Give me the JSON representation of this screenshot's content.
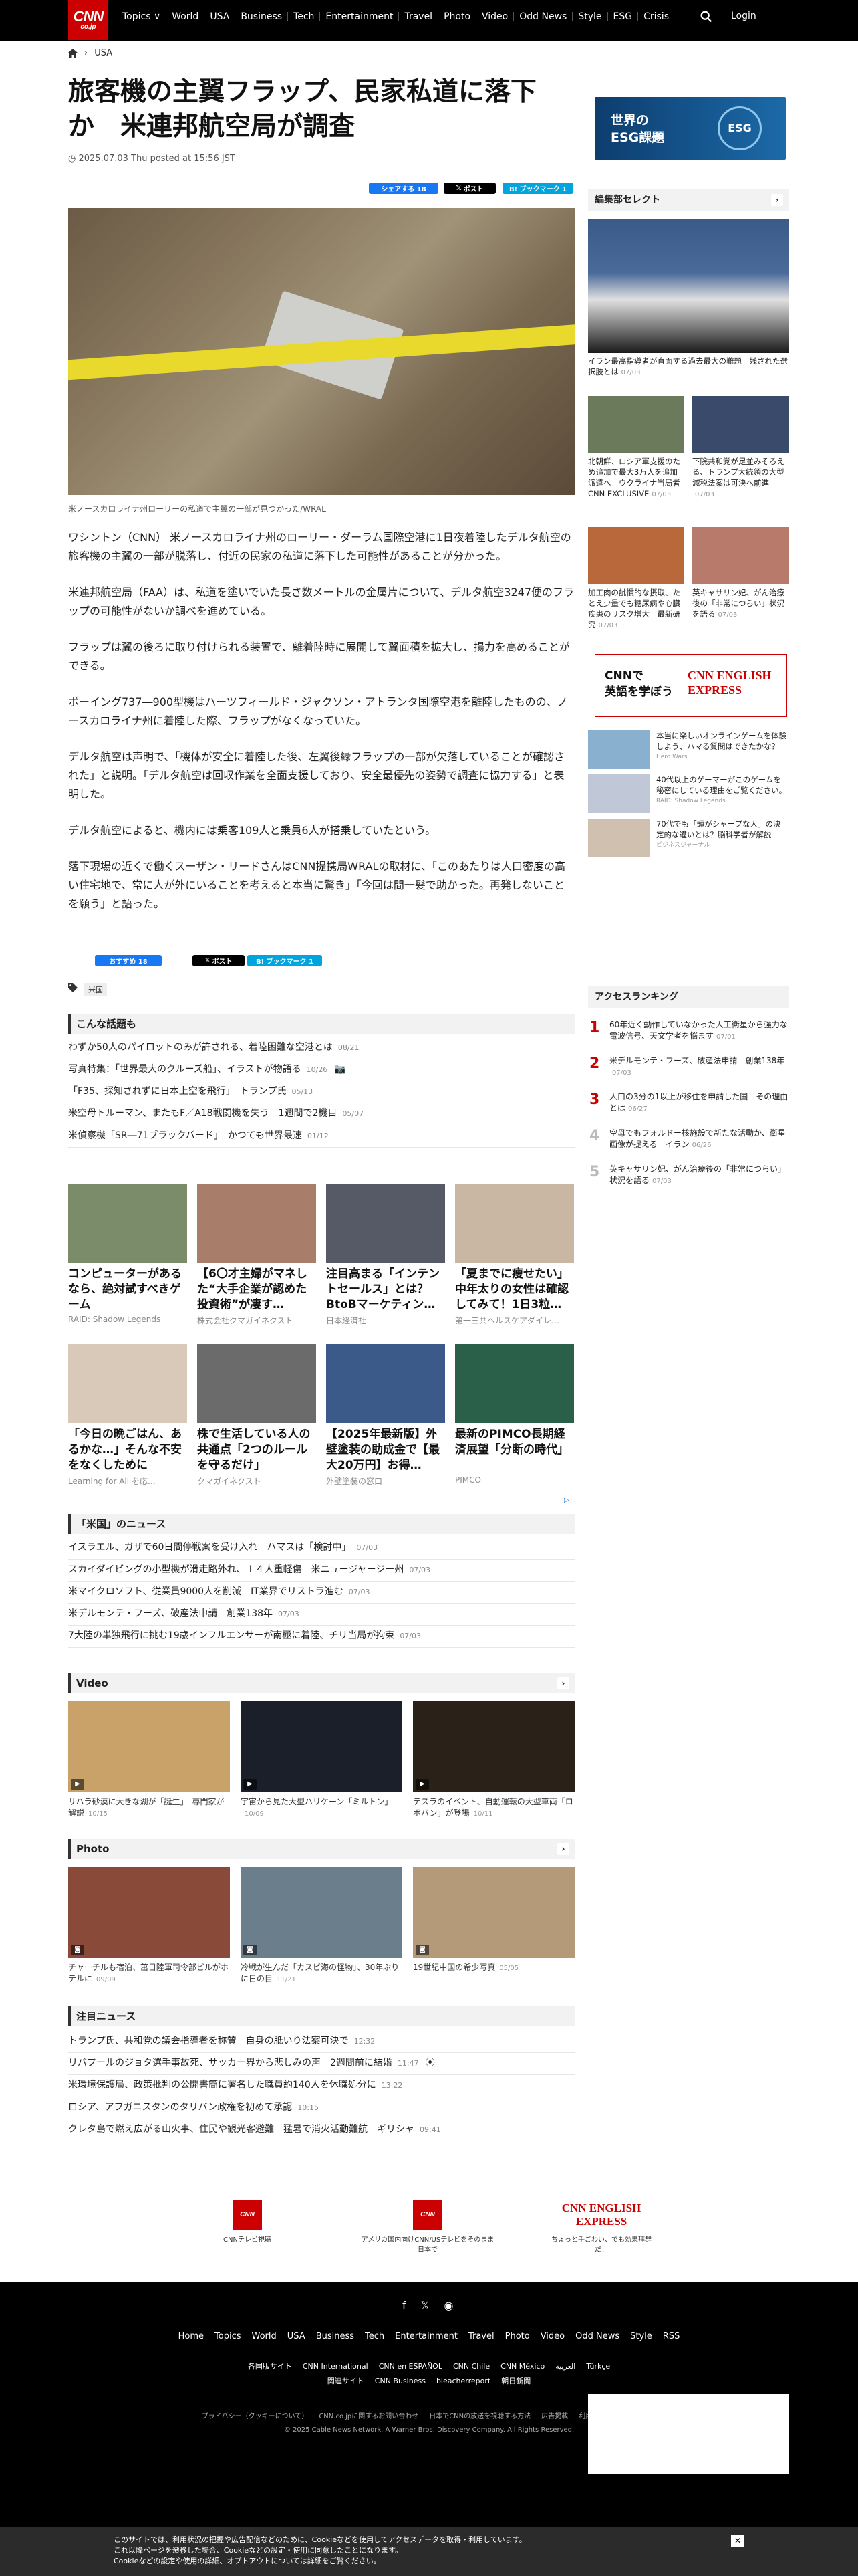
{
  "header": {
    "logo_line1": "CNN",
    "logo_line2": "co.jp",
    "topics_label": "Topics ∨",
    "nav": [
      "World",
      "USA",
      "Business",
      "Tech",
      "Entertainment",
      "Travel",
      "Photo",
      "Video",
      "Odd News",
      "Style",
      "ESG",
      "Crisis"
    ],
    "login": "Login"
  },
  "breadcrumb": {
    "section": "USA"
  },
  "article": {
    "title": "旅客機の主翼フラップ、民家私道に落下か　米連邦航空局が調査",
    "date": "2025.07.03 Thu posted at 15:56 JST",
    "share_fb": "シェアする 18",
    "share_x": "ポスト",
    "share_hatena": "B! ブックマーク 1",
    "caption": "米ノースカロライナ州ローリーの私道で主翼の一部が見つかった/WRAL",
    "paragraphs": [
      "ワシントン（CNN） 米ノースカロライナ州のローリー・ダーラム国際空港に1日夜着陸したデルタ航空の旅客機の主翼の一部が脱落し、付近の民家の私道に落下した可能性があることが分かった。",
      "米連邦航空局（FAA）は、私道を塗いでいた長さ数メートルの金属片について、デルタ航空3247便のフラップの可能性がないか調べを進めている。",
      "フラップは翼の後ろに取り付けられる装置で、離着陸時に展開して翼面積を拡大し、揚力を高めることができる。",
      "ボーイング737―900型機はハーツフィールド・ジャクソン・アトランタ国際空港を離陸したものの、ノースカロライナ州に着陸した際、フラップがなくなっていた。",
      "デルタ航空は声明で、「機体が安全に着陸した後、左翼後縁フラップの一部が欠落していることが確認された」と説明。「デルタ航空は回収作業を全面支援しており、安全最優先の姿勢で調査に協力する」と表明した。",
      "デルタ航空によると、機内には乗客109人と乗員6人が搭乗していたという。",
      "落下現場の近くで働くスーザン・リードさんはCNN提携局WRALの取材に、「このあたりは人口密度の高い住宅地で、常に人が外にいることを考えると本当に驚き」「今回は間一髪で助かった。再発しないことを願う」と語った。"
    ],
    "bottom_fb": "おすすめ 18",
    "bottom_x": "ポスト",
    "bottom_hatena": "B! ブックマーク 1",
    "tag": "米国"
  },
  "topics": {
    "heading": "こんな話題も",
    "items": [
      {
        "t": "わずか50人のパイロットのみが許される、着陸困難な空港とは",
        "d": "08/21"
      },
      {
        "t": "写真特集：「世界最大のクルーズ船」、イラストが物語る",
        "d": "10/26"
      },
      {
        "t": "「F35、探知されずに日本上空を飛行」　トランプ氏",
        "d": "05/13"
      },
      {
        "t": "米空母トルーマン、またもF／A18戦闘機を失う　1週間で2機目",
        "d": "05/07"
      },
      {
        "t": "米偵察機「SR―71ブラックバード」　かつても世界最速",
        "d": "01/12"
      }
    ]
  },
  "ads": [
    {
      "t": "コンピューターがあるなら、絶対試すべきゲーム",
      "s": "RAID: Shadow Legends",
      "c": "#7b8c6a"
    },
    {
      "t": "【6〇才主婦がマネした“大手企業が認めた投資術”が凄す…",
      "s": "株式会社クマガイネクスト",
      "c": "#a87d6a"
    },
    {
      "t": "注目高まる「インテントセールス」とは？BtoBマーケティン…",
      "s": "日本経済社",
      "c": "#555a66"
    },
    {
      "t": "「夏までに痩せたい」中年太りの女性は確認してみて！1日3粒…",
      "s": "第一三共ヘルスケアダイレ…",
      "c": "#c9b7a4"
    },
    {
      "t": "「今日の晩ごはん、あるかな…」そんな不安をなくしために",
      "s": "Learning for All を応…",
      "c": "#d8c9b8"
    },
    {
      "t": "株で生活している人の共通点「2つのルールを守るだけ」",
      "s": "クマガイネクスト",
      "c": "#6b6b6b"
    },
    {
      "t": "【2025年最新版】外壁塗装の助成金で【最大20万円】お得…",
      "s": "外壁塗装の窓口",
      "c": "#3b5a8a"
    },
    {
      "t": "最新のPIMCO長期経済展望「分断の時代」",
      "s": "PIMCO",
      "c": "#2a5f4a"
    }
  ],
  "usnews": {
    "heading": "「米国」のニュース",
    "items": [
      {
        "t": "イスラエル、ガザで60日間停戦案を受け入れ　ハマスは「検討中」",
        "d": "07/03"
      },
      {
        "t": "スカイダイビングの小型機が滑走路外れ、１４人重軽傷　米ニュージャージー州",
        "d": "07/03"
      },
      {
        "t": "米マイクロソフト、従業員9000人を削減　IT業界でリストラ進む",
        "d": "07/03"
      },
      {
        "t": "米デルモンテ・フーズ、破産法申請　創業138年",
        "d": "07/03"
      },
      {
        "t": "7大陸の単独飛行に挑む19歳インフルエンサーが南極に着陸、チリ当局が拘束",
        "d": "07/03"
      }
    ]
  },
  "video": {
    "heading": "Video",
    "items": [
      {
        "t": "サハラ砂漠に大きな湖が「誕生」　専門家が解説",
        "d": "10/15",
        "c": "#c9a26a"
      },
      {
        "t": "宇宙から見た大型ハリケーン「ミルトン」",
        "d": "10/09",
        "c": "#1a1f2a"
      },
      {
        "t": "テスラのイベント、自動運転の大型車両「ロボバン」が登場",
        "d": "10/11",
        "c": "#2a2218"
      }
    ]
  },
  "photo": {
    "heading": "Photo",
    "items": [
      {
        "t": "チャーチルも宿泊、茁日陸軍司令部ビルがホテルに",
        "d": "09/09",
        "c": "#8a4a3a"
      },
      {
        "t": "冷戦が生んだ「カスピ海の怪物」、30年ぶりに日の目",
        "d": "11/21",
        "c": "#6a7e8c"
      },
      {
        "t": "19世紀中国の希少写真",
        "d": "05/05",
        "c": "#b59a7a"
      }
    ]
  },
  "featured": {
    "heading": "注目ニュース",
    "items": [
      {
        "t": "トランプ氏、共和党の議会指導者を称賛　自身の胝いり法案可決で",
        "d": "12:32"
      },
      {
        "t": "リバプールのジョタ選手事故死、サッカー界から悲しみの声　2週間前に結婚",
        "d": "11:47"
      },
      {
        "t": "米環境保護局、政策批判の公開書簡に署名した職員約140人を休職処分に",
        "d": "13:22"
      },
      {
        "t": "ロシア、アフガニスタンのタリバン政権を初めて承認",
        "d": "10:15"
      },
      {
        "t": "クレタ島で燃え広がる山火事、住民や観光客避難　猛暑で消火活動難航　ギリシャ",
        "d": "09:41"
      }
    ]
  },
  "bottom_banners": [
    {
      "logo": "CNN",
      "t": "CNNテレビ視聴"
    },
    {
      "logo": "CNN",
      "t": "アメリカ国内向けCNN/USテレビをそのまま日本で"
    },
    {
      "logo": "CNN ENGLISH EXPRESS",
      "t": "ちょっと手ごわい、でも効果拜群だ！"
    }
  ],
  "sidebar": {
    "esg_title": "世界の\nESG課題",
    "esg_circle": "ESG",
    "editor_heading": "編集部セレクト",
    "editor_main": {
      "t": "イラン最高指導者が直面する過去最大の難題　残された選択肢とは",
      "d": "07/03"
    },
    "editor_items": [
      {
        "t": "北朝鮮、ロシア軍支援のため追加で最大3万人を追加派遣へ　ウクライナ当局者　CNN EXCLUSIVE",
        "d": "07/03",
        "c": "#6a7a5a"
      },
      {
        "t": "下院共和党が足並みそろえる、トランプ大統領の大型減税法案は可決へ前進",
        "d": "07/03",
        "c": "#3a4a6a"
      },
      {
        "t": "加工肉の訿慣的な摂取、たとえ少量でも糖尿病や心臓疾患のリスク増大　最新研究",
        "d": "07/03",
        "c": "#b8683a"
      },
      {
        "t": "英キャサリン妃、がん治療後の「非常につらい」状況を語る",
        "d": "07/03",
        "c": "#b87a6a"
      }
    ],
    "ad_banner_text": "CNNで\n英語を学ぼう",
    "ad_banner_logo": "CNN ENGLISH EXPRESS",
    "side_ads": [
      {
        "t": "本当に楽しいオンラインゲームを体験しよう、ハマる質問はできたかな？",
        "s": "Hero Wars",
        "c": "#8ab0d0"
      },
      {
        "t": "40代以上のゲーマーがこのゲームを秘密にしている理由をご覧ください。",
        "s": "RAID: Shadow Legends",
        "c": "#c0c8d8"
      },
      {
        "t": "70代でも「頭がシャープな人」の決定的な違いとは？脳科学者が解説",
        "s": "ビジネスジャーナル",
        "c": "#d0c0b0"
      }
    ],
    "ranking_heading": "アクセスランキング",
    "ranking": [
      {
        "n": "1",
        "t": "60年近く動作していなかった人工衛星から強力な電波信号、天文学者を悩ます",
        "d": "07/01"
      },
      {
        "n": "2",
        "t": "米デルモンテ・フーズ、破産法申請　創業138年",
        "d": "07/03"
      },
      {
        "n": "3",
        "t": "人口の3分の1以上が移住を申請した国　その理由とは",
        "d": "06/27"
      },
      {
        "n": "4",
        "t": "空母でもフォルドー核施設で新たな活動か、衛星画像が捉える　イラン",
        "d": "06/26"
      },
      {
        "n": "5",
        "t": "英キャサリン妃、がん治療後の「非常につらい」状況を語る",
        "d": "07/03"
      }
    ]
  },
  "footer": {
    "links1": [
      "Home",
      "Topics",
      "World",
      "USA",
      "Business",
      "Tech",
      "Entertainment",
      "Travel",
      "Photo",
      "Video",
      "Odd News",
      "Style",
      "RSS"
    ],
    "links2": [
      "各国版サイト",
      "CNN International",
      "CNN en ESPAÑOL",
      "CNN Chile",
      "CNN México",
      "العربية",
      "Türkçe"
    ],
    "links3": [
      "関連サイト",
      "CNN Business",
      "bleacherreport",
      "朝日新聞"
    ],
    "links4": [
      "プライバシー（クッキーについて）",
      "CNN.co.jpに関するお問い合わせ",
      "日本でCNNの放送を視聴する方法",
      "広告掲載",
      "利用規約",
      "サイトマップ"
    ],
    "copyright": "© 2025 Cable News Network. A Warner Bros. Discovery Company. All Rights Reserved."
  },
  "cookie": {
    "line1": "このサイトでは、利用状況の把握や広告配信などのために、Cookieなどを使用してアクセスデータを取得・利用しています。",
    "line2": "これ以降ページを遷移した場合、Cookieなどの設定・使用に同意したことになります。",
    "line3": "Cookieなどの設定や使用の詳細、オプトアウトについては詳細をご覧ください。"
  }
}
